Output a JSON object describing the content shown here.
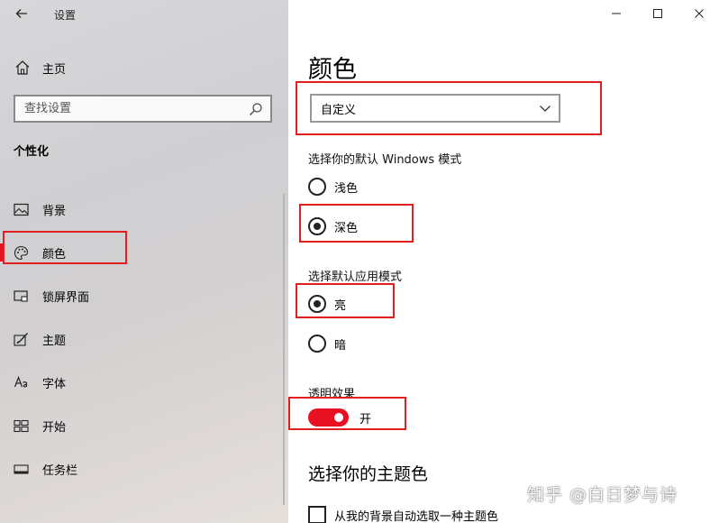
{
  "window": {
    "title": "设置",
    "back_icon": "back-arrow-icon",
    "controls": [
      "minimize-icon",
      "maximize-icon",
      "close-icon"
    ]
  },
  "sidebar": {
    "home_label": "主页",
    "search_placeholder": "查找设置",
    "section": "个性化",
    "items": [
      {
        "label": "背景",
        "icon": "picture-icon"
      },
      {
        "label": "颜色",
        "icon": "palette-icon",
        "active": true
      },
      {
        "label": "锁屏界面",
        "icon": "lock-screen-icon"
      },
      {
        "label": "主题",
        "icon": "theme-brush-icon"
      },
      {
        "label": "字体",
        "icon": "font-icon"
      },
      {
        "label": "开始",
        "icon": "start-grid-icon"
      },
      {
        "label": "任务栏",
        "icon": "taskbar-icon"
      }
    ]
  },
  "main": {
    "title": "颜色",
    "color_dropdown": {
      "selected": "自定义"
    },
    "windows_mode": {
      "label": "选择你的默认 Windows 模式",
      "options": [
        {
          "label": "浅色",
          "checked": false
        },
        {
          "label": "深色",
          "checked": true
        }
      ]
    },
    "app_mode": {
      "label": "选择默认应用模式",
      "options": [
        {
          "label": "亮",
          "checked": true
        },
        {
          "label": "暗",
          "checked": false
        }
      ]
    },
    "transparency": {
      "label": "透明效果",
      "state": "开",
      "on": true
    },
    "accent_title": "选择你的主题色",
    "auto_accent": {
      "label": "从我的背景自动选取一种主题色",
      "checked": false
    }
  },
  "watermark": "知乎 @白日梦与诗",
  "colors": {
    "accent": "#e81123",
    "highlight": "#e02020"
  }
}
